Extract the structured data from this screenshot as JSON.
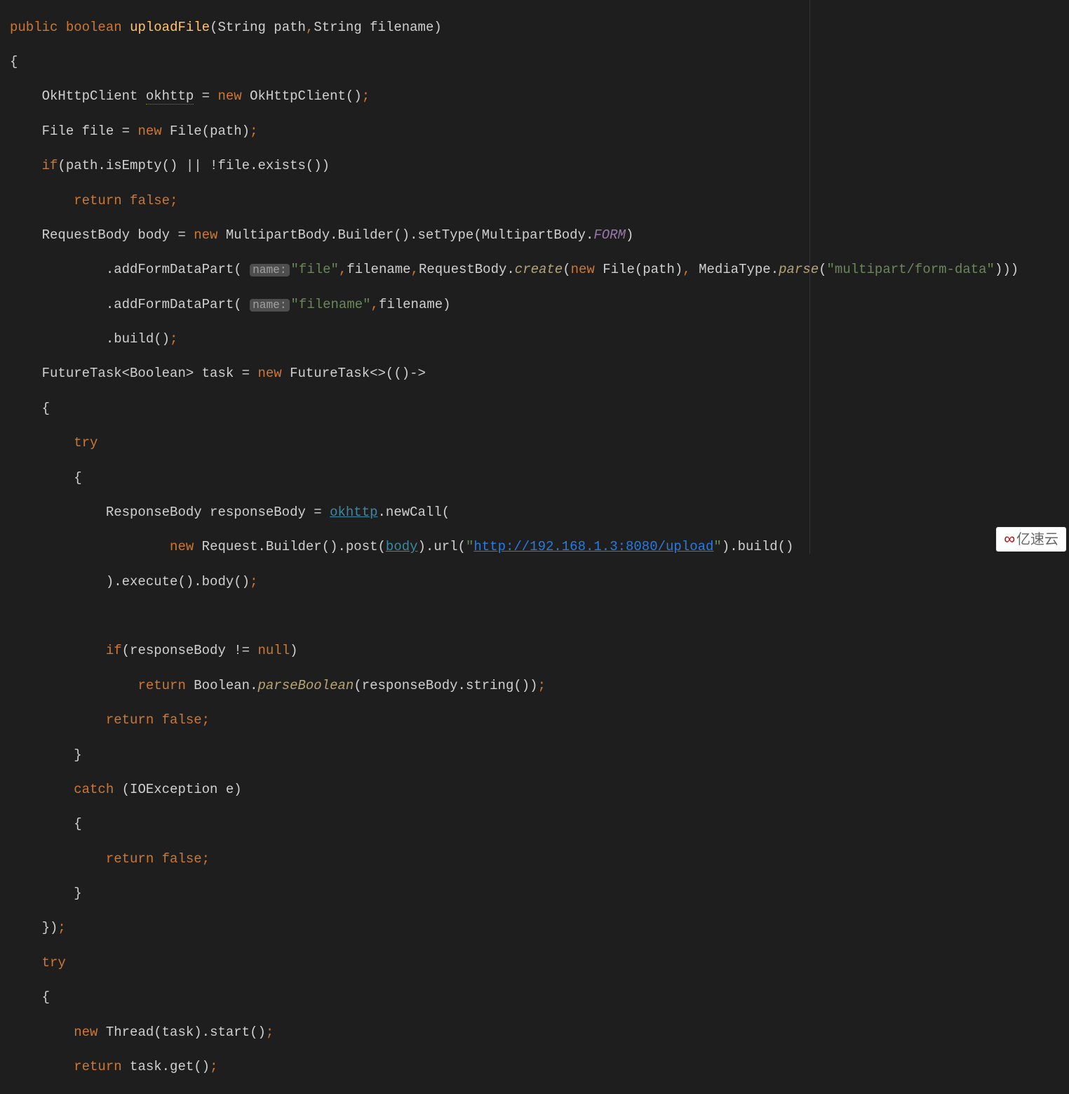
{
  "tokens": {
    "public": "public",
    "boolean": "boolean",
    "method_name": "uploadFile",
    "sig_rest": "(String path",
    "sig_rest2": "String filename)",
    "open_brace": "{",
    "close_brace": "}",
    "new": "new",
    "if": "if",
    "return": "return",
    "false": "false",
    "null": "null",
    "try": "try",
    "catch": "catch",
    "okhttp_decl": "OkHttpClient ",
    "okhttp_var": "okhttp",
    "eq": " = ",
    "okhttp_ctor": " OkHttpClient()",
    "file_decl": "File file = ",
    "file_ctor": " File(path)",
    "if_cond": "(path.isEmpty() || !file.exists())",
    "rb_decl": "RequestBody body = ",
    "mpb": " MultipartBody.Builder().setType(MultipartBody.",
    "form": "FORM",
    "close_paren": ")",
    "addFDP": ".addFormDataPart(",
    "hint_name": "name:",
    "str_file": "\"file\"",
    "str_filename": "\"filename\"",
    "str_multipart": "\"multipart/form-data\"",
    "filename_arg": "filename",
    "rb_create_pre": "RequestBody.",
    "create": "create",
    "new_file_path": " File(path)",
    "mediatype_pre": " MediaType.",
    "parse": "parse",
    "triple_close": ")))",
    "build": ".build()",
    "ft_decl": "FutureTask<Boolean> task = ",
    "ft_ctor": " FutureTask<>(()->",
    "resp_decl": "ResponseBody responseBody = ",
    "newcall": ".newCall(",
    "req_builder": " Request.Builder().post(",
    "body_var": "body",
    "url_pre": ").url(",
    "url_str": "http://192.168.1.3:8080/upload",
    "build2": ").build()",
    "exec_body": ").execute().body()",
    "if_resp": "(responseBody != ",
    "bool_parse_pre": " Boolean.",
    "parseBoolean": "parseBoolean",
    "parse_arg": "(responseBody.string())",
    "catch_arg": " (IOException e)",
    "lambda_close": "})",
    "thread_start": " Thread(task).start()",
    "task_get": " task.get()",
    "semi": ";",
    "comma": ",",
    "paren_open": "(",
    "quote": "\""
  },
  "watermark": "亿速云"
}
